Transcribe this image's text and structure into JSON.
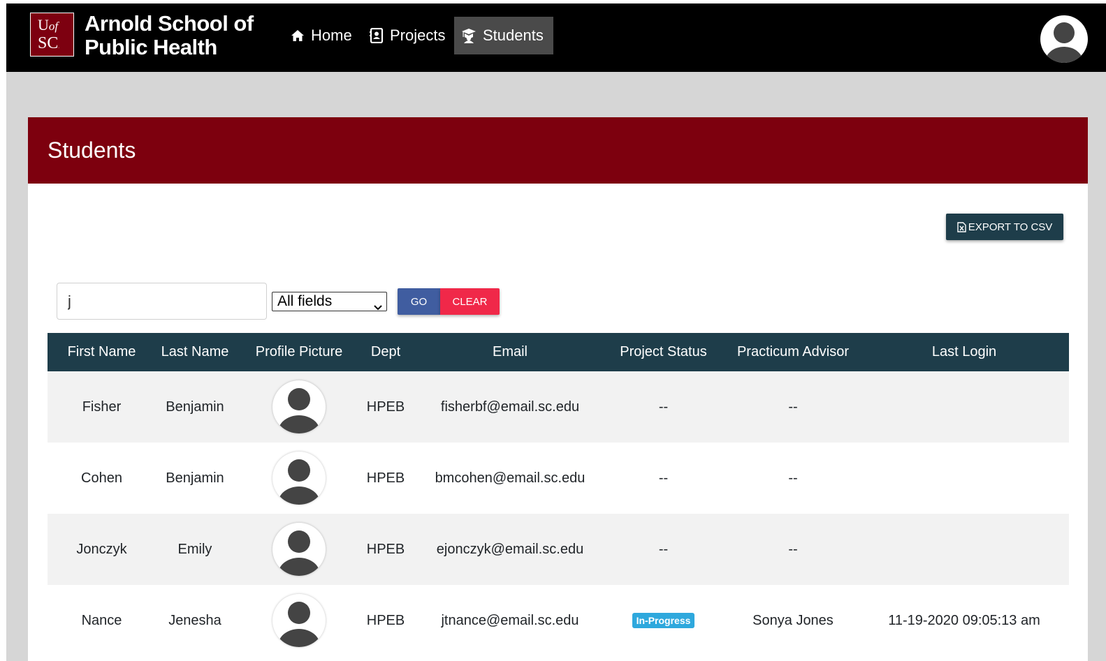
{
  "navbar": {
    "logo": {
      "line1_u": "U",
      "line1_of": "of",
      "line2": "SC",
      "line2_mark": "."
    },
    "brand_line1": "Arnold School of",
    "brand_line2": "Public Health",
    "links": [
      {
        "label": "Home",
        "icon": "home-icon",
        "active": false
      },
      {
        "label": "Projects",
        "icon": "contact-card-icon",
        "active": false
      },
      {
        "label": "Students",
        "icon": "graduation-cap-icon",
        "active": true
      }
    ],
    "user_avatar_icon": "user-icon"
  },
  "page": {
    "title": "Students",
    "export_label": "EXPORT TO CSV",
    "search": {
      "value": "j",
      "placeholder": ""
    },
    "filter_selected": "All fields",
    "go_label": "GO",
    "clear_label": "CLEAR"
  },
  "table": {
    "headers": [
      "First Name",
      "Last Name",
      "Profile Picture",
      "Dept",
      "Email",
      "Project Status",
      "Practicum Advisor",
      "Last Login"
    ],
    "rows": [
      {
        "first": "Fisher",
        "last": "Benjamin",
        "dept": "HPEB",
        "email": "fisherbf@email.sc.edu",
        "status": "--",
        "status_badge": false,
        "advisor": "--",
        "last_login": ""
      },
      {
        "first": "Cohen",
        "last": "Benjamin",
        "dept": "HPEB",
        "email": "bmcohen@email.sc.edu",
        "status": "--",
        "status_badge": false,
        "advisor": "--",
        "last_login": ""
      },
      {
        "first": "Jonczyk",
        "last": "Emily",
        "dept": "HPEB",
        "email": "ejonczyk@email.sc.edu",
        "status": "--",
        "status_badge": false,
        "advisor": "--",
        "last_login": ""
      },
      {
        "first": "Nance",
        "last": "Jenesha",
        "dept": "HPEB",
        "email": "jtnance@email.sc.edu",
        "status": "In-Progress",
        "status_badge": true,
        "advisor": "Sonya Jones",
        "last_login": "11-19-2020 09:05:13 am"
      }
    ]
  },
  "colors": {
    "garnet": "#7d000e",
    "dark_teal": "#1e3d4a",
    "go_blue": "#405da0",
    "clear_red": "#f02849",
    "badge_blue": "#2ea8dd"
  }
}
